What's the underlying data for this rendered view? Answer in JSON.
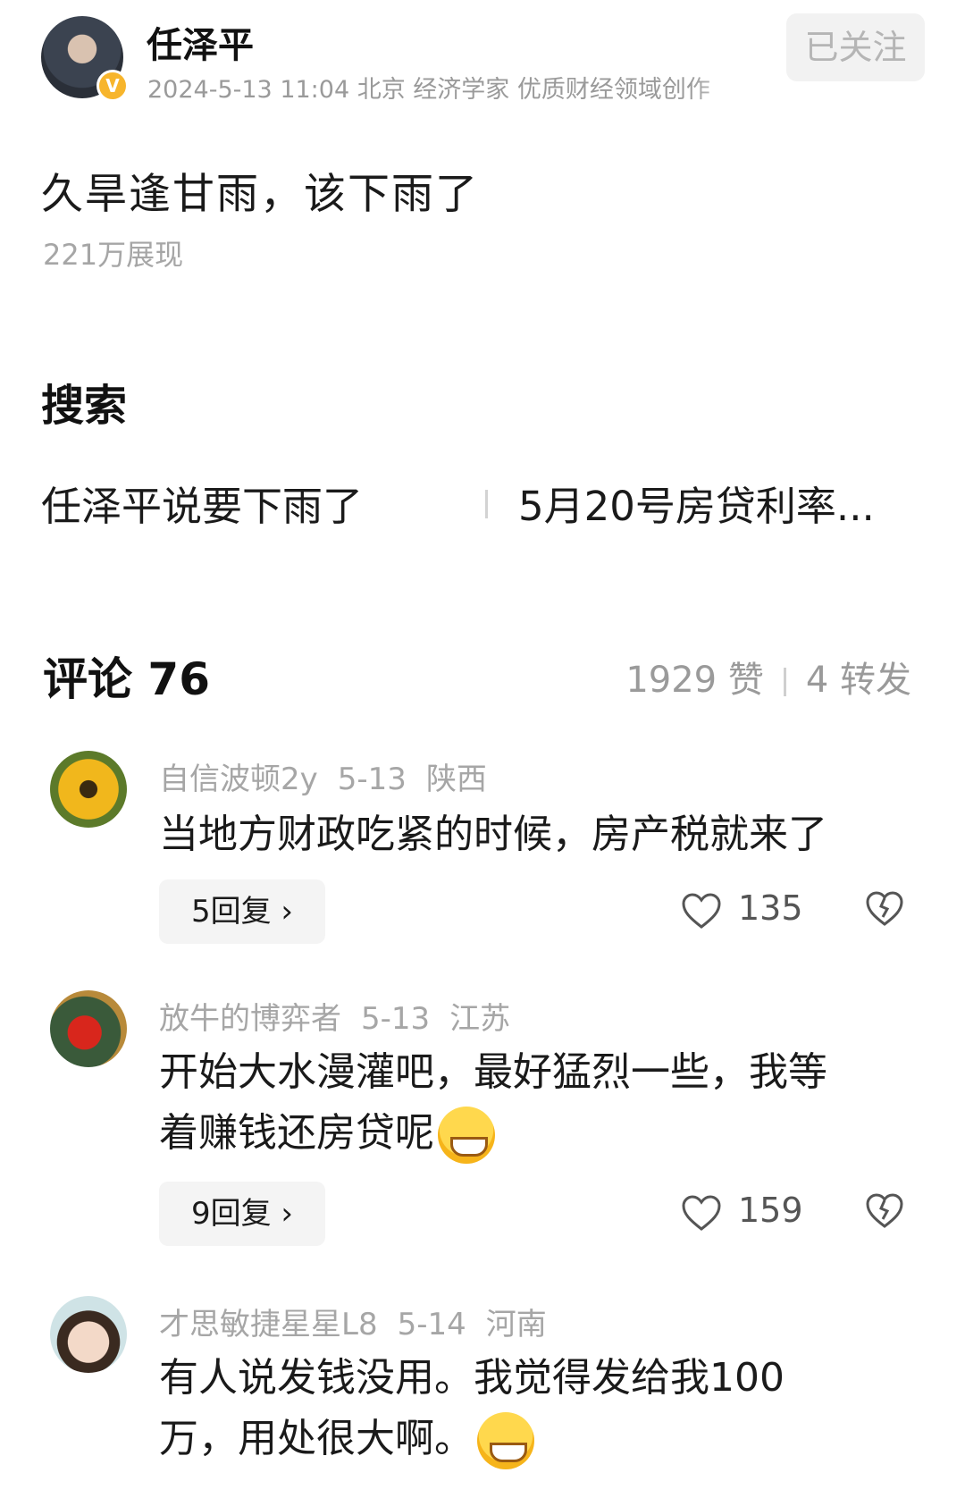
{
  "author": {
    "name": "任泽平",
    "meta": "2024-5-13 11:04 北京 经济学家 优质财经领域创作",
    "verified_badge": "V",
    "follow_label": "已关注"
  },
  "post": {
    "text": "久旱逢甘雨，该下雨了",
    "impressions": "221万展现"
  },
  "search": {
    "title": "搜索",
    "suggestions": [
      "任泽平说要下雨了",
      "5月20号房贷利率..."
    ]
  },
  "comments_header": {
    "title": "评论 76",
    "likes": "1929 赞",
    "reposts": "4 转发"
  },
  "comments": [
    {
      "user": "自信波顿2y",
      "date": "5-13",
      "location": "陕西",
      "text": "当地方财政吃紧的时候，房产税就来了",
      "replies": "5回复 ›",
      "likes": "135"
    },
    {
      "user": "放牛的博弈者",
      "date": "5-13",
      "location": "江苏",
      "text_line1": "开始大水漫灌吧，最好猛烈一些，我等",
      "text_line2": "着赚钱还房贷呢",
      "emoji": "laughing-crying-emoji",
      "replies": "9回复 ›",
      "likes": "159"
    },
    {
      "user": "才思敏捷星星L8",
      "date": "5-14",
      "location": "河南",
      "text_line1": "有人说发钱没用。我觉得发给我100",
      "text_line2": "万，用处很大啊。",
      "emoji": "grinning-emoji"
    }
  ],
  "colors": {
    "text": "#1a1a1a",
    "meta": "#9a9a9a",
    "badge": "#f7b52c",
    "button_bg": "#f4f4f4"
  }
}
